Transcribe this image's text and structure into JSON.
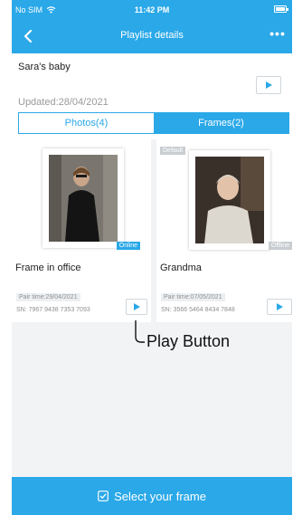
{
  "status_bar": {
    "carrier": "No SIM",
    "time": "11:42 PM"
  },
  "nav": {
    "title": "Playlist details",
    "more_label": "•••"
  },
  "playlist": {
    "name": "Sara's baby",
    "updated": "Updated:28/04/2021"
  },
  "tabs": [
    {
      "label": "Photos(4)",
      "active": false
    },
    {
      "label": "Frames(2)",
      "active": true
    }
  ],
  "frames": [
    {
      "name": "Frame in office",
      "status": "Online",
      "pair_time": "Pair time:29/04/2021",
      "sn": "SN: 7967 9438 7353 7093"
    },
    {
      "name": "Grandma",
      "tag": "Default",
      "status": "Offline",
      "pair_time": "Pair time:07/05/2021",
      "sn": "SN: 3566 5464 8434 7848"
    }
  ],
  "bottom_button": {
    "label": "Select your frame"
  },
  "annotation": {
    "label": "Play Button"
  },
  "colors": {
    "accent": "#2aa8e8",
    "badge_gray": "#c8cdd2",
    "background": "#f2f3f5"
  }
}
